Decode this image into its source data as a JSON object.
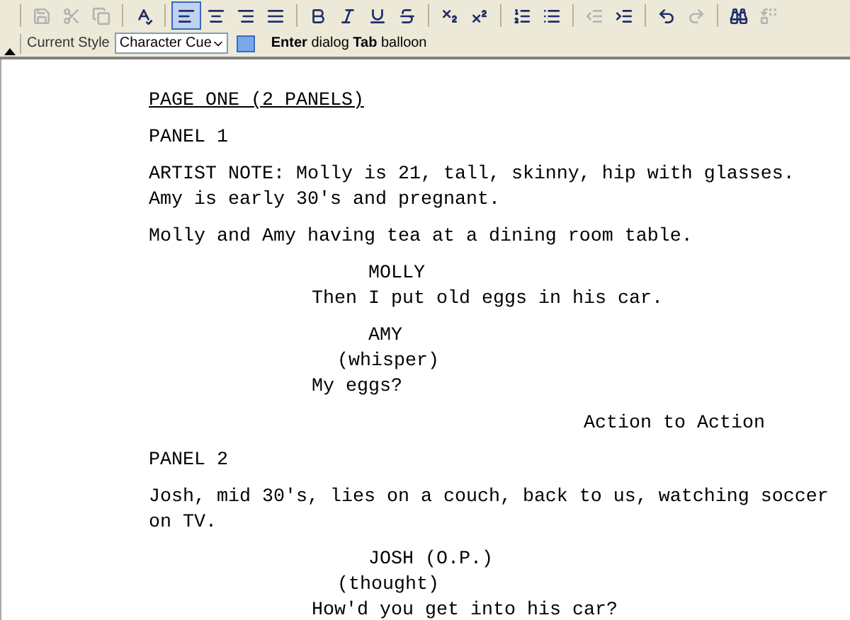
{
  "toolbar": {
    "groups": [
      {
        "buttons": [
          {
            "disabled": true
          },
          {
            "disabled": true
          },
          {
            "disabled": true
          }
        ]
      },
      {
        "buttons": [
          {
            "disabled": false
          }
        ]
      },
      {
        "buttons": [
          {
            "disabled": false,
            "selected": true
          },
          {
            "disabled": false,
            "selected": false
          },
          {
            "disabled": false,
            "selected": false
          },
          {
            "disabled": false,
            "selected": false
          }
        ]
      },
      {
        "buttons": [
          {
            "disabled": false
          },
          {
            "disabled": false
          },
          {
            "disabled": false
          },
          {
            "disabled": false
          }
        ]
      },
      {
        "buttons": [
          {
            "disabled": false
          },
          {
            "disabled": false
          }
        ]
      },
      {
        "buttons": [
          {
            "disabled": false
          },
          {
            "disabled": false
          }
        ]
      },
      {
        "buttons": [
          {
            "disabled": true
          },
          {
            "disabled": false
          }
        ]
      },
      {
        "buttons": [
          {
            "disabled": false
          },
          {
            "disabled": true
          }
        ]
      },
      {
        "buttons": [
          {
            "disabled": false
          },
          {
            "disabled": true
          }
        ]
      }
    ]
  },
  "style_bar": {
    "label": "Current Style",
    "value": "Character Cue",
    "hint": "**Enter** dialog **Tab** balloon"
  },
  "script": [
    {
      "kind": "heading",
      "text": "PAGE ONE (2 PANELS)"
    },
    {
      "kind": "action",
      "text": "PANEL 1"
    },
    {
      "kind": "action",
      "text": "ARTIST NOTE: Molly is 21, tall, skinny, hip with glasses. Amy is early 30's and pregnant."
    },
    {
      "kind": "action",
      "text": "Molly and Amy having tea at a dining room table."
    },
    {
      "kind": "character",
      "text": "MOLLY"
    },
    {
      "kind": "dialogue",
      "text": "Then I put old eggs in his car."
    },
    {
      "kind": "character",
      "text": "AMY"
    },
    {
      "kind": "parenthetical",
      "text": "(whisper)"
    },
    {
      "kind": "dialogue",
      "text": "My eggs?"
    },
    {
      "kind": "transition",
      "text": "Action to Action"
    },
    {
      "kind": "action",
      "text": "PANEL 2"
    },
    {
      "kind": "action",
      "text": "Josh, mid 30's, lies on a couch, back to us, watching soccer on TV."
    },
    {
      "kind": "character",
      "text": "JOSH (O.P.)"
    },
    {
      "kind": "parenthetical",
      "text": "(thought)"
    },
    {
      "kind": "dialogue",
      "text": "How'd you get into his car?"
    }
  ]
}
